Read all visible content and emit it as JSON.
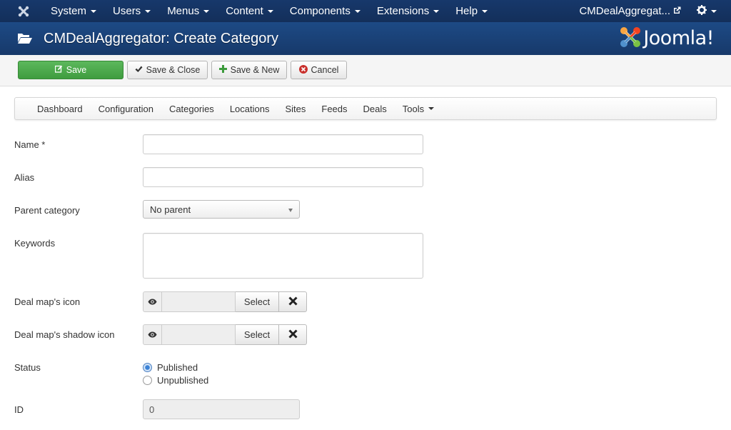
{
  "topbar": {
    "logo_icon": "joomla-icon",
    "menu": [
      {
        "label": "System"
      },
      {
        "label": "Users"
      },
      {
        "label": "Menus"
      },
      {
        "label": "Content"
      },
      {
        "label": "Components"
      },
      {
        "label": "Extensions"
      },
      {
        "label": "Help"
      }
    ],
    "site_link": "CMDealAggregat...",
    "user_icon": "gear-icon"
  },
  "header": {
    "title": "CMDealAggregator: Create Category",
    "brand": "Joomla!",
    "brand_icon": "joomla-logo-icon",
    "folder_icon": "folder-open-icon"
  },
  "toolbar": {
    "save": "Save",
    "save_close": "Save & Close",
    "save_new": "Save & New",
    "cancel": "Cancel"
  },
  "subnav": {
    "items": [
      {
        "label": "Dashboard"
      },
      {
        "label": "Configuration"
      },
      {
        "label": "Categories"
      },
      {
        "label": "Locations"
      },
      {
        "label": "Sites"
      },
      {
        "label": "Feeds"
      },
      {
        "label": "Deals"
      },
      {
        "label": "Tools"
      }
    ]
  },
  "form": {
    "name_label": "Name *",
    "name_value": "",
    "alias_label": "Alias",
    "alias_value": "",
    "parent_label": "Parent category",
    "parent_value": "No parent",
    "keywords_label": "Keywords",
    "keywords_value": "",
    "map_icon_label": "Deal map's icon",
    "map_shadow_label": "Deal map's shadow icon",
    "select_label": "Select",
    "status_label": "Status",
    "status_options": [
      "Published",
      "Unpublished"
    ],
    "status_selected": "Published",
    "id_label": "ID",
    "id_value": "0"
  },
  "colors": {
    "topbar": "#17386b",
    "header": "#1d4a85",
    "save_green": "#4cae4c",
    "cancel_red": "#c9302c"
  }
}
